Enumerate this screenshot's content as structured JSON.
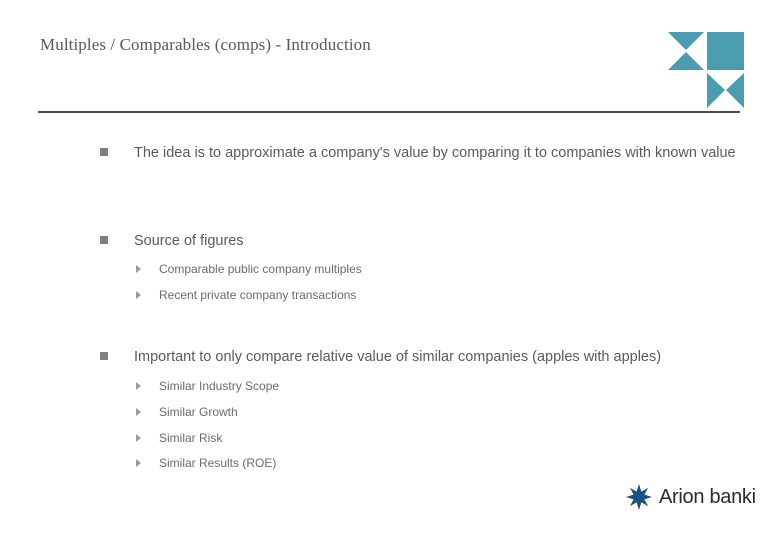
{
  "slide": {
    "title": "Multiples / Comparables (comps) - Introduction",
    "accent_color": "#4a9db0",
    "rule_color": "#4d4d4d",
    "text_color": "#5a5a5a"
  },
  "corporate_mark": {
    "icon_name": "arion-geometric-mark",
    "color": "#4a9db0"
  },
  "content": {
    "bullets": [
      {
        "marker": "square-bullet",
        "text": "The idea is to approximate a company's value by comparing it to companies with known value",
        "sub": []
      },
      {
        "marker": "square-bullet",
        "text": "Source of figures",
        "sub": [
          {
            "marker": "triangle-bullet",
            "text": "Comparable public company multiples"
          },
          {
            "marker": "triangle-bullet",
            "text": "Recent private company transactions"
          }
        ]
      },
      {
        "marker": "square-bullet",
        "text": "Important to only compare relative value of similar companies (apples with apples)",
        "sub": [
          {
            "marker": "triangle-bullet",
            "text": "Similar Industry Scope"
          },
          {
            "marker": "triangle-bullet",
            "text": "Similar Growth"
          },
          {
            "marker": "triangle-bullet",
            "text": "Similar Risk"
          },
          {
            "marker": "triangle-bullet",
            "text": "Similar Results (ROE)"
          }
        ]
      }
    ]
  },
  "footer": {
    "logo_icon_name": "arion-starburst-icon",
    "logo_text": "Arion banki",
    "logo_icon_color": "#1f4e79",
    "logo_text_color": "#2b2b2b"
  }
}
